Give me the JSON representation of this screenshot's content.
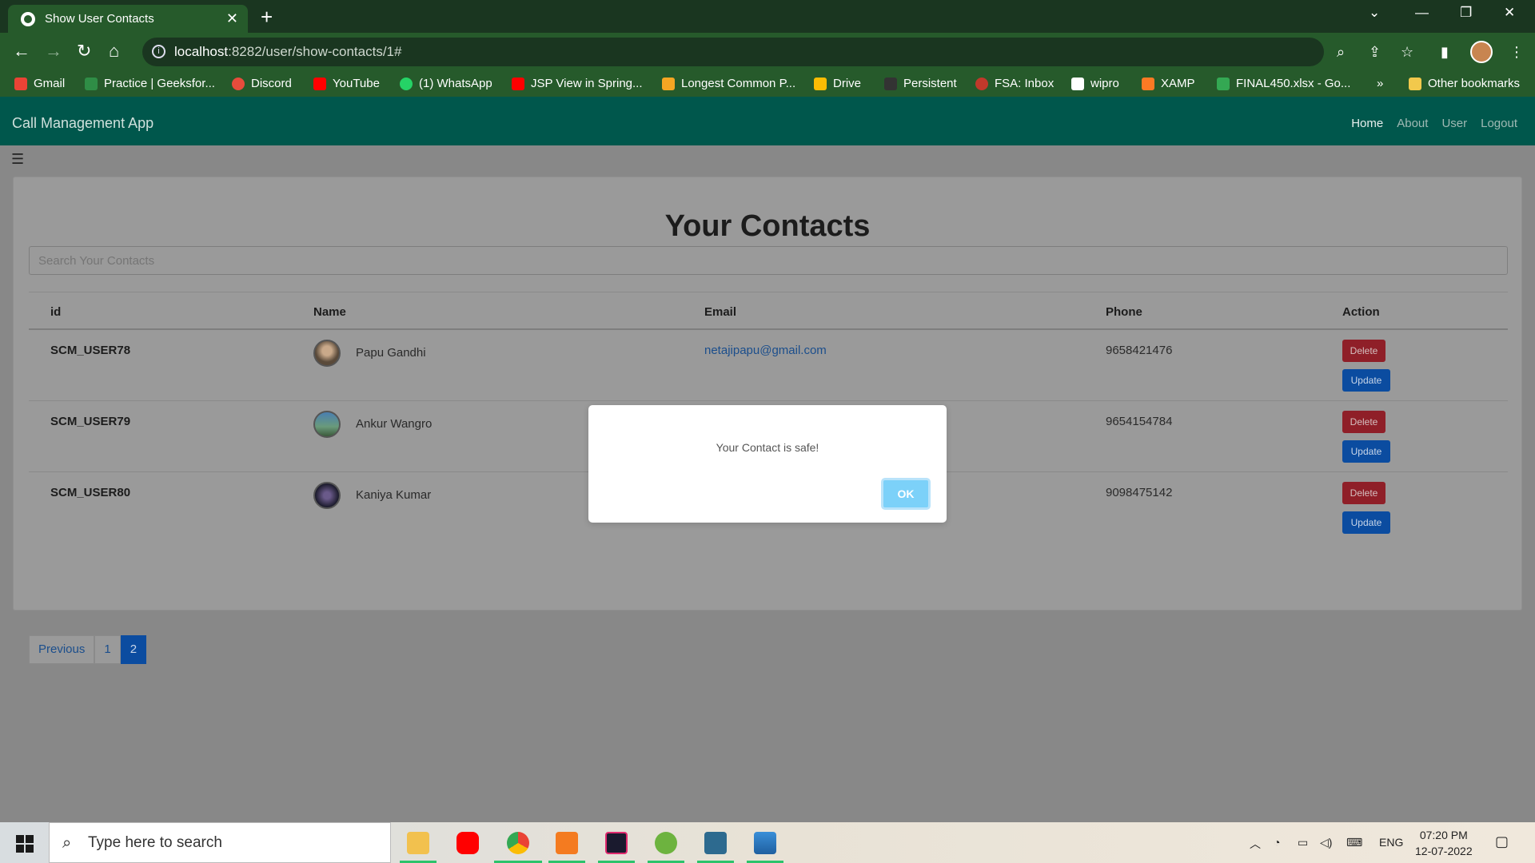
{
  "browser": {
    "tab_title": "Show User Contacts",
    "tab_close": "✕",
    "new_tab": "+",
    "url_host": "localhost",
    "url_path": ":8282/user/show-contacts/1#",
    "bookmarks": [
      {
        "label": "Gmail",
        "color": "#ea4335"
      },
      {
        "label": "Practice | GeeksforGeeks...",
        "display": "Practice | Geeksfor...",
        "color": "#2f8d46"
      },
      {
        "label": "Discord",
        "color": "#e74c3c"
      },
      {
        "label": "YouTube",
        "color": "#ff0000"
      },
      {
        "label": "(1) WhatsApp",
        "color": "#25d366"
      },
      {
        "label": "JSP View in Spring...",
        "color": "#ff0000"
      },
      {
        "label": "Longest Common P...",
        "color": "#f5a623"
      },
      {
        "label": "Drive",
        "color": "#fbbc04"
      },
      {
        "label": "Persistent",
        "color": "#333333"
      },
      {
        "label": "FSA: Inbox",
        "color": "#c0392b"
      },
      {
        "label": "wipro",
        "color": "#ffffff"
      },
      {
        "label": "XAMP",
        "color": "#fb7a24"
      },
      {
        "label": "FINAL450.xlsx - Go...",
        "color": "#34a853"
      }
    ],
    "bookmarks_more": "»",
    "other_bookmarks": "Other bookmarks"
  },
  "app": {
    "brand": "Call Management App",
    "nav": [
      "Home",
      "About",
      "User",
      "Logout"
    ],
    "page_title": "Your Contacts",
    "search_placeholder": "Search Your Contacts",
    "columns": [
      "id",
      "Name",
      "Email",
      "Phone",
      "Action"
    ],
    "contacts": [
      {
        "id": "SCM_USER78",
        "name": "Papu Gandhi",
        "email": "netajipapu@gmail.com",
        "phone": "9658421476"
      },
      {
        "id": "SCM_USER79",
        "name": "Ankur Wangro",
        "email": "",
        "phone": "9654154784"
      },
      {
        "id": "SCM_USER80",
        "name": "Kaniya Kumar",
        "email": "",
        "phone": "9098475142"
      }
    ],
    "delete_label": "Delete",
    "update_label": "Update",
    "pagination": [
      "Previous",
      "1",
      "2"
    ],
    "active_page": "2"
  },
  "modal": {
    "message": "Your Contact is safe!",
    "ok_label": "OK"
  },
  "taskbar": {
    "search_placeholder": "Type here to search",
    "language": "ENG",
    "time": "07:20 PM",
    "date": "12-07-2022"
  },
  "colors": {
    "navbar": "#00574c",
    "delete": "#8f1f28",
    "update": "#0b4ca0",
    "ok_button": "#7cd1f9"
  }
}
